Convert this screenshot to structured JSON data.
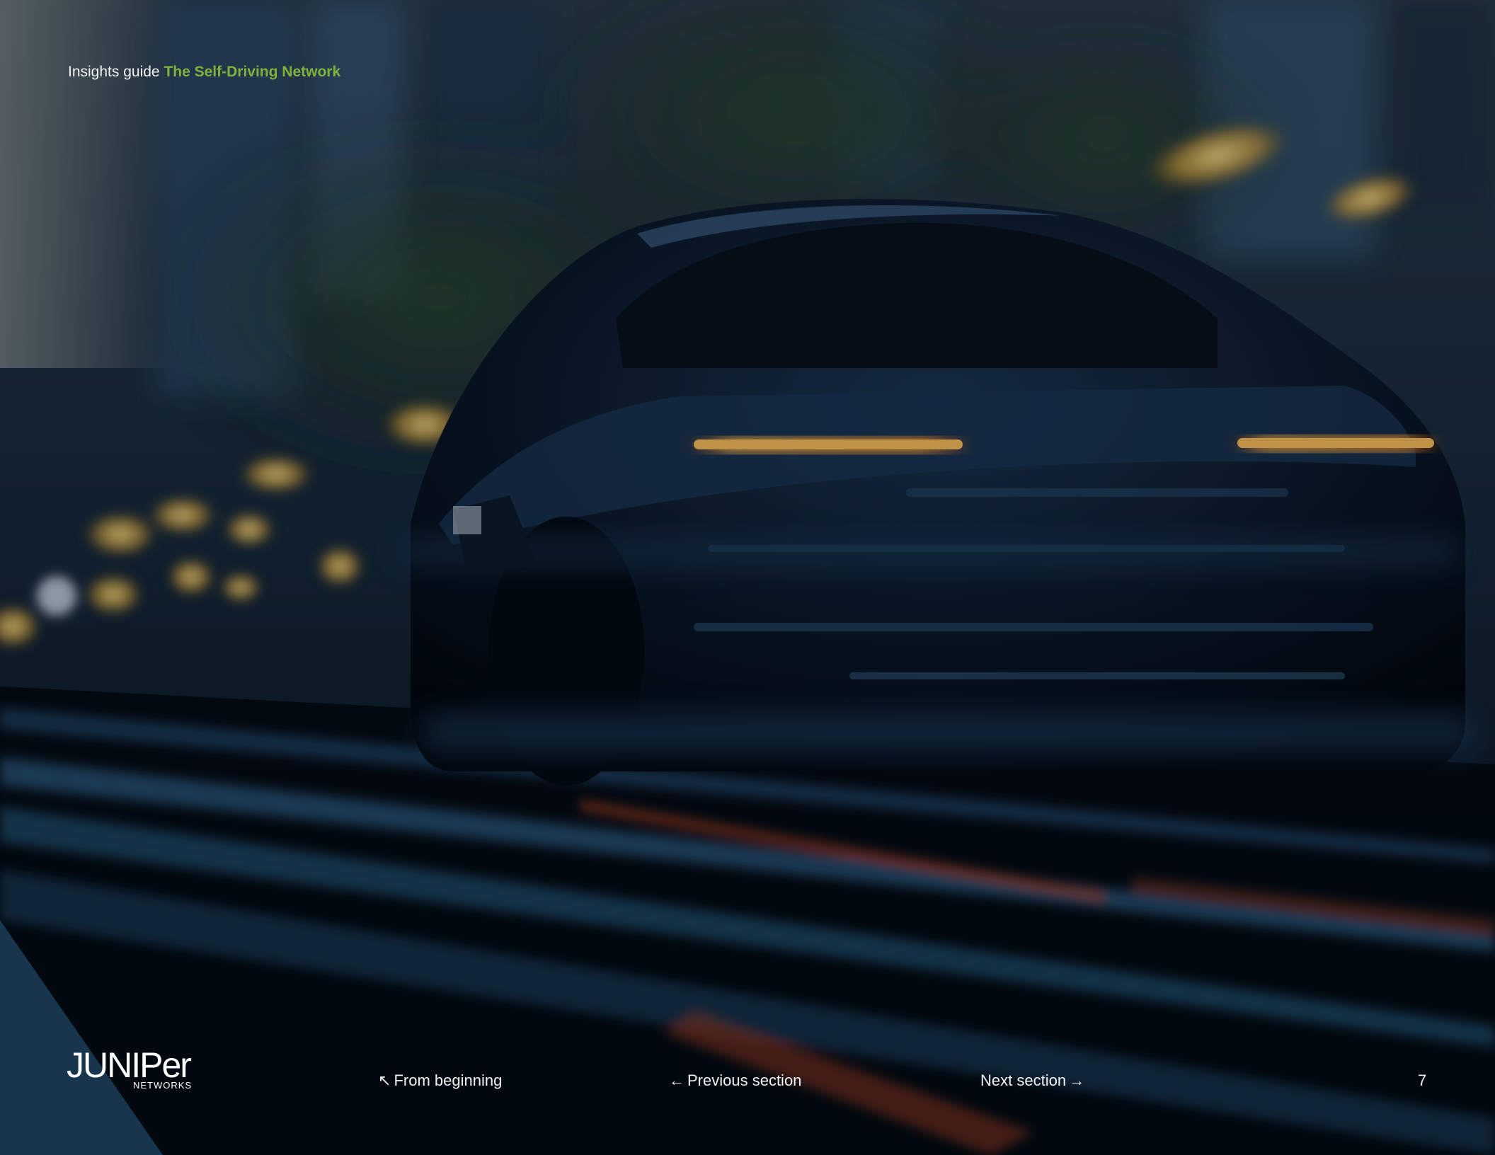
{
  "header": {
    "label": "Insights guide",
    "title": "The Self-Driving Network"
  },
  "brand": {
    "logo_word": "JUNIPer",
    "logo_sub": "NETWORKS"
  },
  "footer": {
    "from_beginning": "From beginning",
    "previous_section": "Previous section",
    "next_section": "Next section",
    "page_number": "7"
  },
  "icons": {
    "from_beginning": "arrow-up-left-icon",
    "previous_section": "arrow-left-icon",
    "next_section": "arrow-right-icon"
  },
  "colors": {
    "accent": "#7fb23a",
    "text": "#f2f2f2",
    "background": "#05121f"
  }
}
